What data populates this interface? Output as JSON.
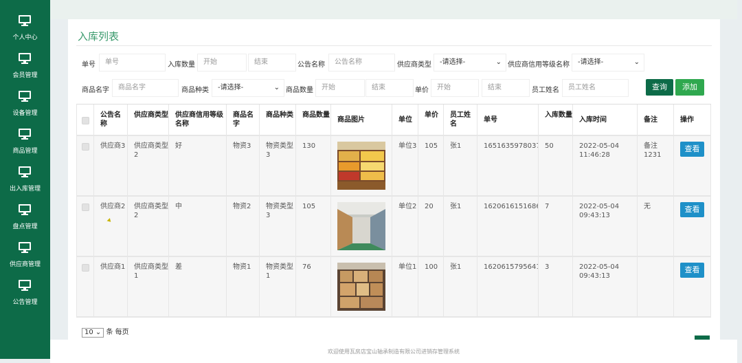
{
  "sidebar": {
    "items": [
      {
        "label": "个人中心"
      },
      {
        "label": "会员管理"
      },
      {
        "label": "设备管理"
      },
      {
        "label": "商品管理"
      },
      {
        "label": "出入库管理"
      },
      {
        "label": "盘点管理"
      },
      {
        "label": "供应商管理"
      },
      {
        "label": "公告管理"
      }
    ]
  },
  "page": {
    "title": "入库列表"
  },
  "filters": {
    "dan_hao_label": "单号",
    "dan_hao_ph": "单号",
    "ruku_qty_label": "入库数量",
    "ruku_qty_start": "开始",
    "ruku_qty_end": "结束",
    "notice_label": "公告名称",
    "notice_ph": "公告名称",
    "supplier_type_label": "供应商类型",
    "supplier_type_value": "-请选择-",
    "credit_label": "供应商信用等级名称",
    "credit_value": "-请选择-",
    "goods_name_label": "商品名字",
    "goods_name_ph": "商品名字",
    "goods_type_label": "商品种类",
    "goods_type_value": "-请选择-",
    "goods_qty_label": "商品数量",
    "goods_qty_start": "开始",
    "goods_qty_end": "结束",
    "price_label": "单价",
    "price_start": "开始",
    "price_end": "结束",
    "staff_label": "员工姓名",
    "staff_ph": "员工姓名",
    "query_btn": "查询",
    "add_btn": "添加"
  },
  "table": {
    "headers": [
      "公告名称",
      "供应商类型",
      "供应商信用等级名称",
      "商品名字",
      "商品种类",
      "商品数量",
      "商品图片",
      "单位",
      "单价",
      "员工姓名",
      "单号",
      "入库数量",
      "入库时间",
      "备注",
      "操作"
    ],
    "rows": [
      {
        "notice": "供应商3",
        "stype": "供应商类型2",
        "credit": "好",
        "name": "物资3",
        "gtype": "物资类型3",
        "qty": "130",
        "unit": "单位3",
        "price": "105",
        "staff": "张1",
        "no": "1651635978037",
        "rqty": "50",
        "time": "2022-05-04 11:46:28",
        "remark": "备注1231",
        "action": "查看",
        "image": "warehouse-shelves"
      },
      {
        "notice": "供应商2",
        "stype": "供应商类型2",
        "credit": "中",
        "name": "物资2",
        "gtype": "物资类型3",
        "qty": "105",
        "unit": "单位2",
        "price": "20",
        "staff": "张1",
        "no": "1620616151686",
        "rqty": "7",
        "time": "2022-05-04 09:43:13",
        "remark": "无",
        "action": "查看",
        "image": "warehouse-aisle"
      },
      {
        "notice": "供应商1",
        "stype": "供应商类型1",
        "credit": "差",
        "name": "物资1",
        "gtype": "物资类型1",
        "qty": "76",
        "unit": "单位1",
        "price": "100",
        "staff": "张1",
        "no": "1620615795641",
        "rqty": "3",
        "time": "2022-05-04 09:43:13",
        "remark": "",
        "action": "查看",
        "image": "warehouse-boxes"
      }
    ]
  },
  "pager": {
    "page_size": "10",
    "suffix": "条 每页"
  },
  "footer": {
    "text": "欢迎使用瓦房店宝山轴承制造有限公司进销存管理系统"
  },
  "colors": {
    "sidebar": "#0d6b48",
    "title": "#3a9a6c",
    "query": "#0d6b48",
    "add": "#2fa84f",
    "view": "#1e90c8"
  }
}
